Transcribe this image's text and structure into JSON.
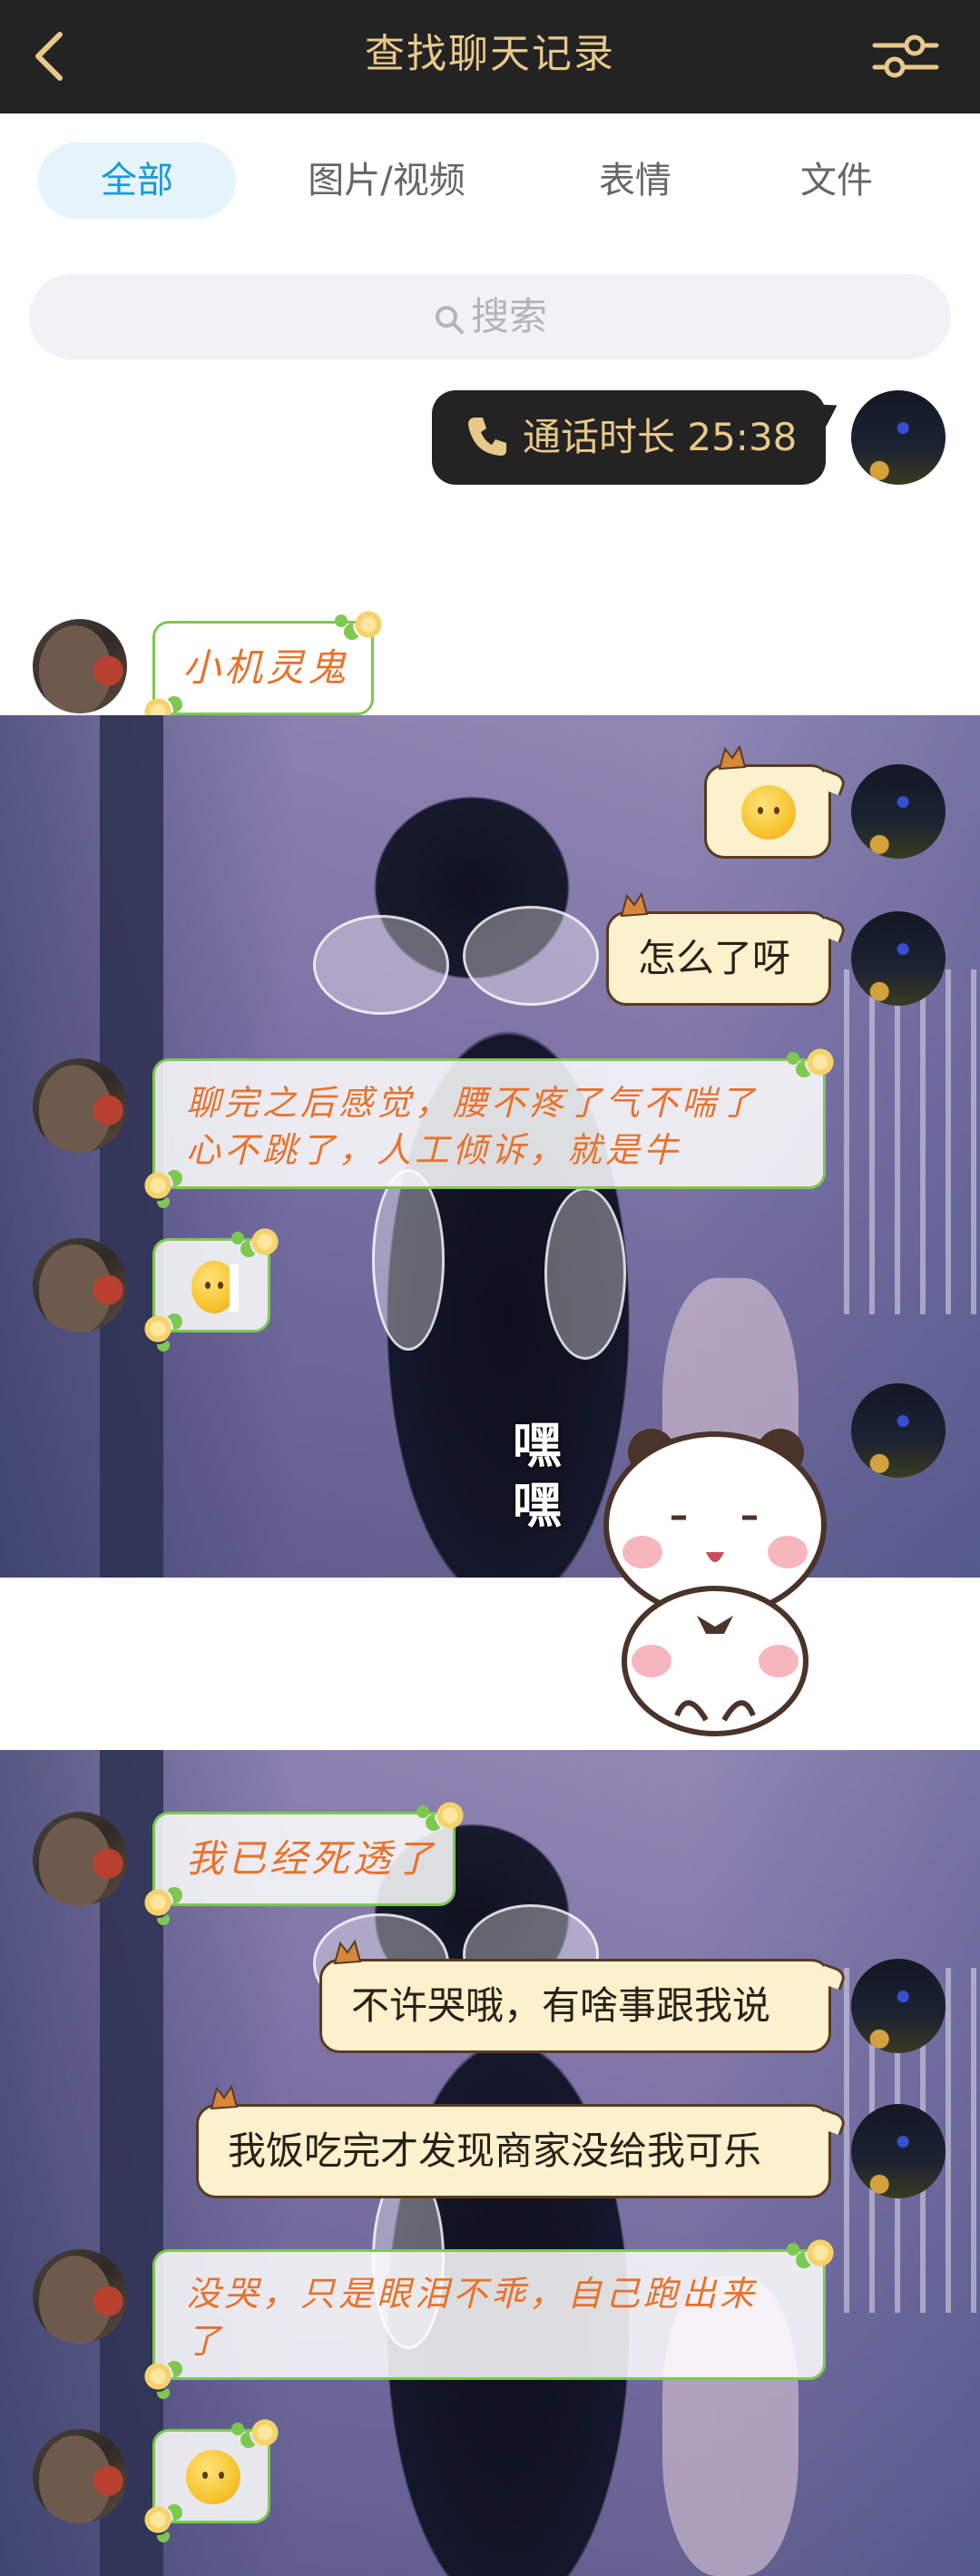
{
  "header": {
    "title": "查找聊天记录",
    "back_icon": "chevron-left-icon",
    "filter_icon": "sliders-icon",
    "bg_color": "#232323",
    "title_color": "#e9c98a"
  },
  "tabs": [
    {
      "label": "全部",
      "active": true
    },
    {
      "label": "图片/视频",
      "active": false
    },
    {
      "label": "表情",
      "active": false
    },
    {
      "label": "文件",
      "active": false
    }
  ],
  "search": {
    "placeholder": "搜索",
    "icon": "search-icon"
  },
  "messages": {
    "call": {
      "text": "通话时长 25:38",
      "icon": "phone-icon"
    },
    "m1": {
      "text": "小机灵鬼"
    },
    "m2": {
      "emoji": "smiling-face-emoji"
    },
    "m3": {
      "text": "怎么了呀"
    },
    "m4": {
      "line1": "聊完之后感觉，腰不疼了气不喘了",
      "line2": "心不跳了，人工倾诉，就是牛"
    },
    "m5": {
      "emoji": "peek-face-emoji"
    },
    "sticker": {
      "caption_top": "嘿",
      "caption_bottom": "嘿",
      "name": "panda-bear-sticker"
    },
    "m6": {
      "text": "我已经死透了"
    },
    "m7": {
      "text": "不许哭哦，有啥事跟我说"
    },
    "m8": {
      "text": "我饭吃完才发现商家没给我可乐"
    },
    "m9": {
      "line1": "没哭，只是眼泪不乖，自己跑出来",
      "line2": "了"
    },
    "m10": {
      "emoji": "grinning-face-emoji"
    }
  },
  "colors": {
    "accent_blue": "#1a9ad6",
    "gold": "#e9c98a",
    "green_border": "#7ec850",
    "orange_text": "#e7732c",
    "cream": "#fbf1cc"
  }
}
